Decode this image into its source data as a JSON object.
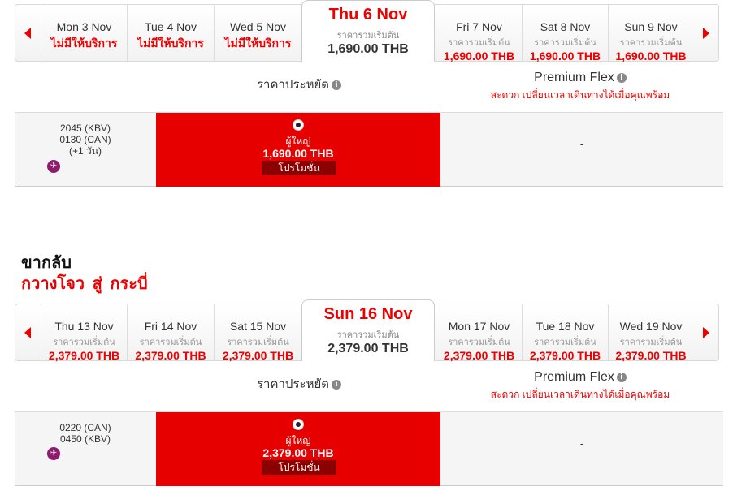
{
  "outbound": {
    "days": [
      {
        "label": "Mon 3 Nov",
        "sub": "",
        "value": "ไม่มีให้บริการ"
      },
      {
        "label": "Tue 4 Nov",
        "sub": "",
        "value": "ไม่มีให้บริการ"
      },
      {
        "label": "Wed 5 Nov",
        "sub": "",
        "value": "ไม่มีให้บริการ"
      },
      {
        "label": "Thu 6 Nov",
        "sub": "ราคารวมเริ่มต้น",
        "value": "1,690.00 THB"
      },
      {
        "label": "Fri 7 Nov",
        "sub": "ราคารวมเริ่มต้น",
        "value": "1,690.00 THB"
      },
      {
        "label": "Sat 8 Nov",
        "sub": "ราคารวมเริ่มต้น",
        "value": "1,690.00 THB"
      },
      {
        "label": "Sun 9 Nov",
        "sub": "ราคารวมเริ่มต้น",
        "value": "1,690.00 THB"
      }
    ],
    "fare_headers": {
      "saver": "ราคาประหยัด",
      "flex_title": "Premium Flex",
      "flex_sub": "สะดวก เปลี่ยนเวลาเดินทางได้เมื่อคุณพร้อม"
    },
    "flight": {
      "depart": "2045  (KBV)",
      "arrive": "0130  (CAN)",
      "next_day": "(+1 วัน)",
      "adult_label": "ผู้ใหญ่",
      "price": "1,690.00 THB",
      "promo": "โปรโมชั่น",
      "flex_value": "-"
    }
  },
  "return_section": {
    "title": "ขากลับ",
    "route": "กวางโจว  สู่  กระบี่"
  },
  "return": {
    "days": [
      {
        "label": "Thu 13 Nov",
        "sub": "ราคารวมเริ่มต้น",
        "value": "2,379.00 THB"
      },
      {
        "label": "Fri 14 Nov",
        "sub": "ราคารวมเริ่มต้น",
        "value": "2,379.00 THB"
      },
      {
        "label": "Sat 15 Nov",
        "sub": "ราคารวมเริ่มต้น",
        "value": "2,379.00 THB"
      },
      {
        "label": "Sun 16 Nov",
        "sub": "ราคารวมเริ่มต้น",
        "value": "2,379.00 THB"
      },
      {
        "label": "Mon 17 Nov",
        "sub": "ราคารวมเริ่มต้น",
        "value": "2,379.00 THB"
      },
      {
        "label": "Tue 18 Nov",
        "sub": "ราคารวมเริ่มต้น",
        "value": "2,379.00 THB"
      },
      {
        "label": "Wed 19 Nov",
        "sub": "ราคารวมเริ่มต้น",
        "value": "2,379.00 THB"
      }
    ],
    "fare_headers": {
      "saver": "ราคาประหยัด",
      "flex_title": "Premium Flex",
      "flex_sub": "สะดวก เปลี่ยนเวลาเดินทางได้เมื่อคุณพร้อม"
    },
    "flight": {
      "depart": "0220  (CAN)",
      "arrive": "0450  (KBV)",
      "adult_label": "ผู้ใหญ่",
      "price": "2,379.00 THB",
      "promo": "โปรโมชั่น",
      "flex_value": "-"
    }
  },
  "colors": {
    "accent": "#e60000",
    "promo": "#8b0000",
    "airline_badge": "#8e1b6e"
  }
}
